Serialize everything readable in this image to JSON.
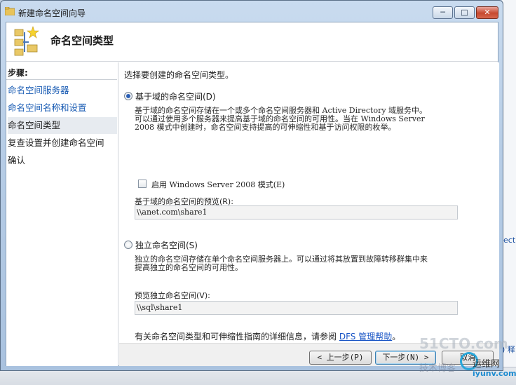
{
  "window": {
    "title": "新建命名空间向导",
    "minimize_glyph": "─",
    "maximize_glyph": "□",
    "close_glyph": "✕"
  },
  "header": {
    "title": "命名空间类型"
  },
  "steps": {
    "heading": "步骤:",
    "items": [
      {
        "label": "命名空间服务器",
        "state": "link"
      },
      {
        "label": "命名空间名称和设置",
        "state": "link"
      },
      {
        "label": "命名空间类型",
        "state": "current"
      },
      {
        "label": "复查设置并创建命名空间",
        "state": "pending"
      },
      {
        "label": "确认",
        "state": "pending"
      }
    ]
  },
  "main": {
    "intro": "选择要创建的命名空间类型。",
    "domain_option": {
      "label": "基于域的命名空间(D)",
      "selected": true,
      "description": [
        "基于域的命名空间存储在一个或多个命名空间服务器和 Active Directory 域服务中。",
        "可以通过使用多个服务器来提高基于域的命名空间的可用性。当在 Windows Server",
        "2008 模式中创建时，命名空间支持提高的可伸缩性和基于访问权限的枚举。"
      ],
      "checkbox_label": "启用 Windows Server 2008 模式(E)",
      "checkbox_checked": false,
      "preview_label": "基于域的命名空间的预览(R):",
      "preview_value": "\\\\anet.com\\share1"
    },
    "standalone_option": {
      "label": "独立命名空间(S)",
      "selected": false,
      "description": [
        "独立的命名空间存储在单个命名空间服务器上。可以通过将其放置到故障转移群集中来",
        "提高独立的命名空间的可用性。"
      ],
      "preview_label": "预览独立命名空间(V):",
      "preview_value": "\\\\sql\\share1"
    },
    "help_text": "有关命名空间类型和可伸缩性指南的详细信息，请参阅",
    "help_link": "DFS 管理帮助",
    "help_suffix": "。"
  },
  "footer": {
    "back": "< 上一步(P)",
    "next": "下一步(N) >",
    "cancel": "取消"
  },
  "background": {
    "fragment_1": "ect",
    "fragment_2": ") 释"
  },
  "watermark": {
    "site": "51CTO.com",
    "tagline": "技术博客",
    "brand": "运维网",
    "domain": "iyunv.com"
  }
}
